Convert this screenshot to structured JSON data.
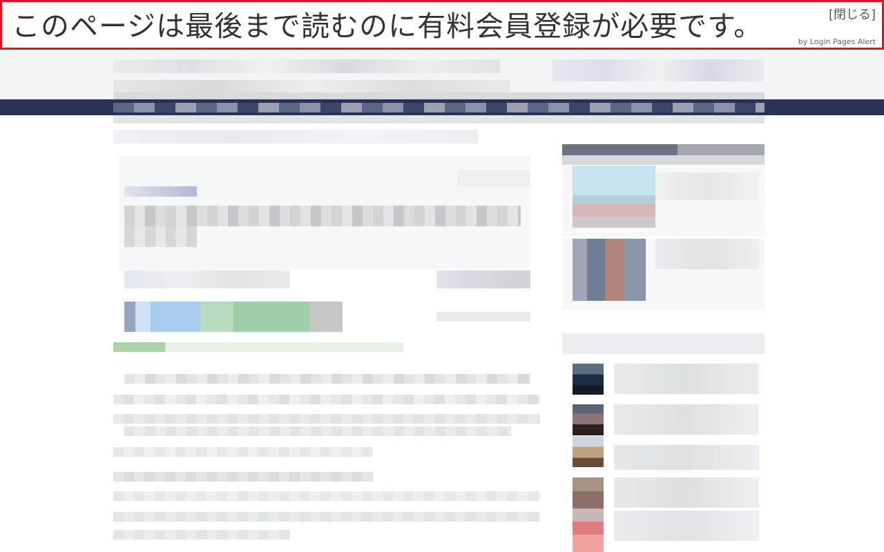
{
  "alert": {
    "message": "このページは最後まで読むのに有料会員登録が必要です。",
    "close_label": "[閉じる]",
    "credit": "by Login Pages Alert",
    "border_color": "#e3121e"
  },
  "colors": {
    "navbar": "#2a3356",
    "header_bg": "#f3f4f7",
    "content_bg": "#ffffff"
  },
  "blurred_content": {
    "state": "pixelated"
  }
}
